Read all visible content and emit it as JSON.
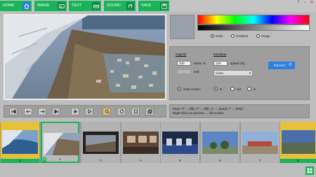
{
  "toolbar": {
    "home": "HOME",
    "image": "IMAGE",
    "text": "TEXT",
    "sound": "SOUND",
    "save": "SAVE",
    "window_controls": [
      "?",
      "–",
      "✕"
    ]
  },
  "color_panel": {
    "options": [
      "Solid",
      "Gradient",
      "Image"
    ],
    "selected": "Solid"
  },
  "settings": {
    "img_vid_label": "Img/Vid",
    "duration_value": "100",
    "duration_label": "durat. %",
    "end_label": "end",
    "transition_label": "transition",
    "speed_value": "100",
    "speed_label": "speed (%)",
    "transition_select": "zoom",
    "reset_label": "RESET",
    "clear_screen_label": "clear-screen",
    "dir_options": [
      "in",
      "out",
      "in"
    ]
  },
  "keys_help": {
    "line1": "Keys: 'F' → (fit), 'F' → (fill), 'a' → (auto); '/' → (info)",
    "line2": "Right-Click on preview → full-screen"
  },
  "filmstrip": {
    "frames": [
      "1",
      "2",
      "3",
      "4",
      "5",
      "6",
      "7",
      "8"
    ],
    "selected_badge": "2"
  },
  "colors": {
    "accent_green": "#19b35a",
    "home_blue": "#2e7bd6",
    "reset_blue": "#2f7fe0",
    "gold": "#e5c23a"
  },
  "icons": [
    "home-icon",
    "image-icon",
    "keyboard-icon",
    "sound-icon",
    "save-icon",
    "grid-icon"
  ]
}
